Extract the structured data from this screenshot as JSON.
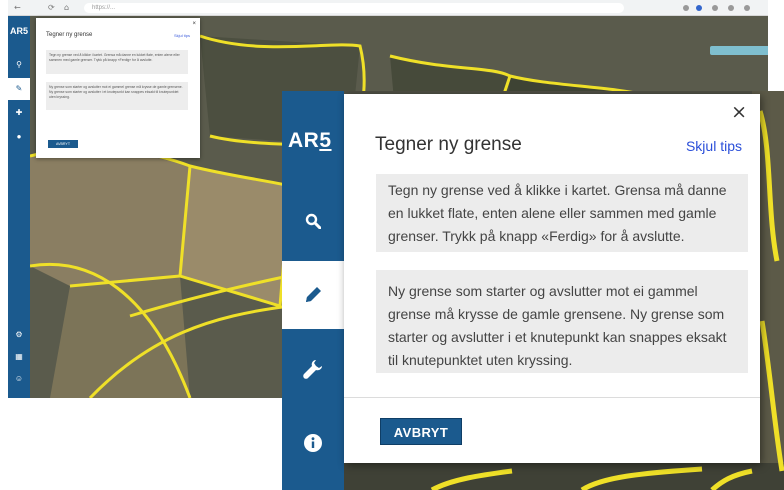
{
  "colors": {
    "sidebar": "#1b5a8e",
    "link": "#2b4fd9",
    "tip_bg": "#ececec",
    "boundary": "#f0e028"
  },
  "background_screenshot": {
    "browser": {
      "nav_back": "←",
      "nav_reload": "⟳",
      "nav_home": "⌂",
      "url": "https://..."
    },
    "sidebar": {
      "logo": "AR5",
      "buttons": [
        "search-icon",
        "pencil-icon",
        "wrench-icon",
        "info-icon",
        "settings-icon",
        "layers-icon",
        "person-icon"
      ]
    },
    "panel": {
      "close": "×",
      "title": "Tegner ny grense",
      "hide_tips": "Skjul tips",
      "tip1": "Tegn ny grense ved å klikke i kartet. Grensa må danne en lukket flate, enten alene eller sammen med gamle grenser. Trykk på knapp «Ferdig» for å avslutte.",
      "tip2": "Ny grense som starter og avslutter mot ei gammel grense må krysse de gamle grensene. Ny grense som starter og avslutter i et knutepunkt kan snappes eksakt til knutepunktet uten kryssing.",
      "cancel": "AVBRYT"
    }
  },
  "sidebar": {
    "logo_main": "AR",
    "logo_sub": "5",
    "buttons": [
      {
        "icon": "search-icon",
        "active": false
      },
      {
        "icon": "pencil-icon",
        "active": true
      },
      {
        "icon": "wrench-icon",
        "active": false
      },
      {
        "icon": "info-icon",
        "active": false
      }
    ]
  },
  "panel": {
    "close_label": "×",
    "title": "Tegner ny grense",
    "hide_tips_label": "Skjul tips",
    "tips": [
      "Tegn ny grense ved å klikke i kartet. Grensa må danne en lukket flate, enten alene eller sammen med gamle grenser. Trykk på knapp «Ferdig» for å avslutte.",
      "Ny grense som starter og avslutter mot ei gammel grense må krysse de gamle grensene. Ny grense som starter og avslutter i et knutepunkt kan snappes eksakt til knutepunktet uten kryssing."
    ],
    "cancel_label": "AVBRYT"
  }
}
